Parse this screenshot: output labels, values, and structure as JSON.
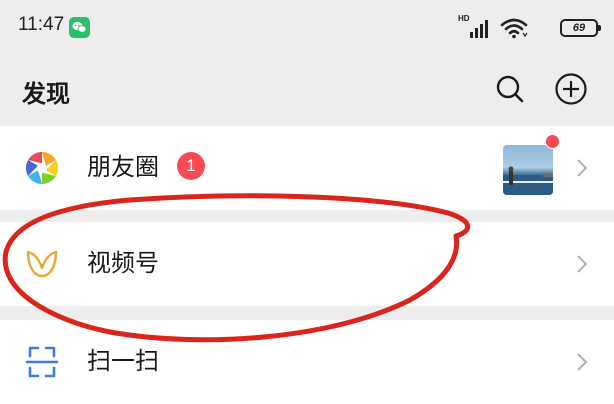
{
  "status_bar": {
    "time": "11:47",
    "network_label": "HD",
    "battery_level": "69",
    "wechat_color": "#2ac06a"
  },
  "header": {
    "title": "发现"
  },
  "list": [
    {
      "label": "朋友圈",
      "badge_count": "1",
      "has_thumbnail": true,
      "icon": "moments-aperture-icon"
    },
    {
      "label": "视频号",
      "icon": "channels-butterfly-icon"
    },
    {
      "label": "扫一扫",
      "icon": "scan-icon"
    }
  ],
  "colors": {
    "background": "#ededed",
    "row_background": "#ffffff",
    "badge_red": "#f74a52",
    "channels_icon_gold": "#e8a83a",
    "scan_icon_blue": "#3d7fd6",
    "annotation_red": "#d9251c"
  }
}
